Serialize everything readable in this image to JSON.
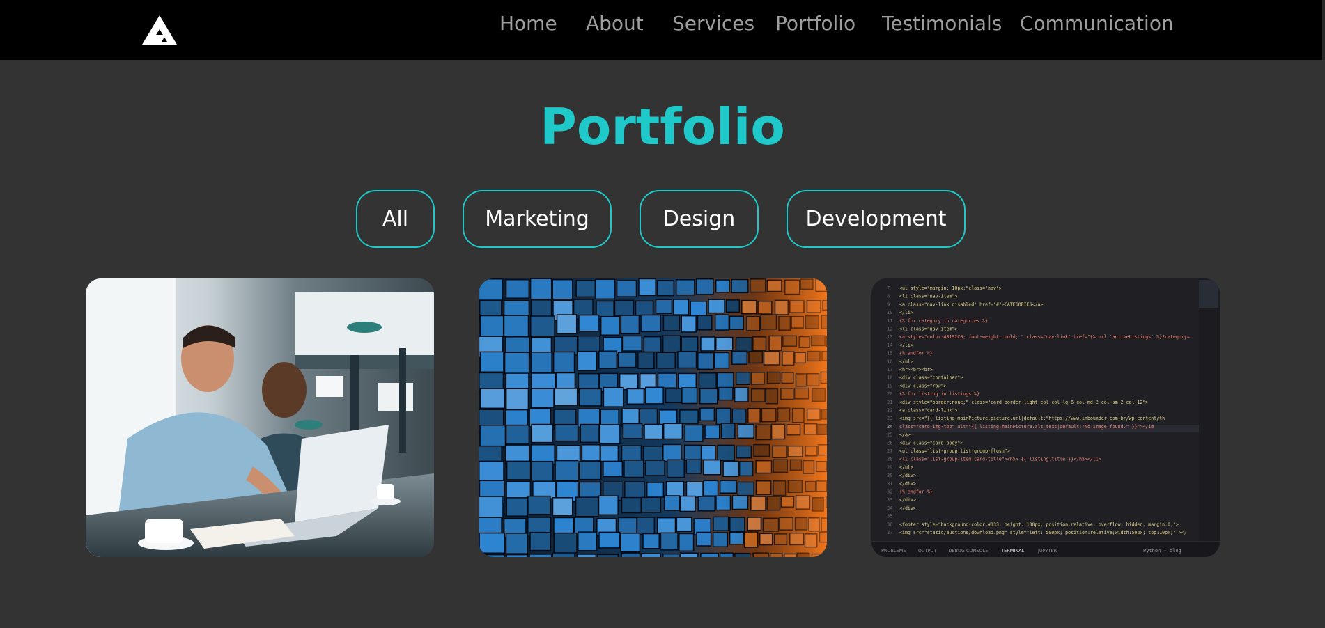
{
  "brand": {
    "logo_icon": "triangle-a-logo-icon"
  },
  "nav": {
    "items": [
      {
        "label": "Home"
      },
      {
        "label": "About"
      },
      {
        "label": "Services"
      },
      {
        "label": "Portfolio"
      },
      {
        "label": "Testimonials"
      },
      {
        "label": "Communication"
      }
    ]
  },
  "portfolio": {
    "title": "Portfolio",
    "filters": [
      {
        "label": "All"
      },
      {
        "label": "Marketing"
      },
      {
        "label": "Design"
      },
      {
        "label": "Development"
      }
    ],
    "items": [
      {
        "image": "business-men-laptop-photo"
      },
      {
        "image": "blue-orange-cubes-abstract-photo"
      },
      {
        "image": "code-editor-screenshot"
      }
    ]
  },
  "colors": {
    "accent": "#1fc9c9",
    "background": "#333333",
    "navbar": "#000000",
    "nav_text": "#9d9d9d"
  },
  "code_editor": {
    "lines": [
      {
        "n": "7",
        "t": "<ul style=\"margin: 10px;\"class=\"nav\">"
      },
      {
        "n": "8",
        "t": "  <li class=\"nav-item\">"
      },
      {
        "n": "9",
        "t": "    <a class=\"nav-link disabled\" href=\"#\">CATEGORIES</a>"
      },
      {
        "n": "10",
        "t": "  </li>"
      },
      {
        "n": "11",
        "t": "  {% for category in categories %}"
      },
      {
        "n": "12",
        "t": "  <li class=\"nav-item\">"
      },
      {
        "n": "13",
        "t": "    <a style=\"color:#0192C0; font-weight: bold; \" class=\"nav-link\" href=\"{% url 'activeListings' %}?category="
      },
      {
        "n": "14",
        "t": "  </li>"
      },
      {
        "n": "15",
        "t": " {% endfor %}"
      },
      {
        "n": "16",
        "t": "</ul>"
      },
      {
        "n": "17",
        "t": "<hr><br><br>"
      },
      {
        "n": "18",
        "t": "<div class=\"container\">"
      },
      {
        "n": "19",
        "t": "  <div class=\"row\">"
      },
      {
        "n": "20",
        "t": "    {% for listing in listings %}"
      },
      {
        "n": "21",
        "t": "      <div style=\"border:none;\" class=\"card border-light col col-lg-6 col-md-2 col-sm-2 col-12\">"
      },
      {
        "n": "22",
        "t": "        <a class=\"card-link\">"
      },
      {
        "n": "23",
        "t": "        <img src=\"{{ listing.mainPicture.picture.url|default:\"https://www.inbounder.com.br/wp-content/th"
      },
      {
        "n": "24",
        "t": "          class=\"card-img-top\" alt=\"{{ listing.mainPicture.alt_text|default:\"No image found.\" }}\"></im"
      },
      {
        "n": "25",
        "t": "        </a>"
      },
      {
        "n": "26",
        "t": "        <div class=\"card-body\">"
      },
      {
        "n": "27",
        "t": "        <ul class=\"list-group list-group-flush\">"
      },
      {
        "n": "28",
        "t": "          <li class=\"list-group-item card-title\"><h5> {{ listing.title }}</h5></li>"
      },
      {
        "n": "29",
        "t": "        </ul>"
      },
      {
        "n": "30",
        "t": "        </div>"
      },
      {
        "n": "31",
        "t": "      </div>"
      },
      {
        "n": "32",
        "t": "    {% endfor %}"
      },
      {
        "n": "33",
        "t": "    </div>"
      },
      {
        "n": "34",
        "t": "  </div>"
      },
      {
        "n": "35",
        "t": ""
      },
      {
        "n": "36",
        "t": "  <footer style=\"background-color:#333; height: 130px; position:relative; overflow: hidden; margin:0;\">"
      },
      {
        "n": "37",
        "t": "    <img src=\"static/auctions/download.png\" style=\"left: 500px; position:relative;width:50px; top:10px;\" ></"
      }
    ],
    "panel_tabs": [
      "PROBLEMS",
      "OUTPUT",
      "DEBUG CONSOLE",
      "TERMINAL",
      "JUPYTER"
    ],
    "panel_status": "Python - blog"
  }
}
